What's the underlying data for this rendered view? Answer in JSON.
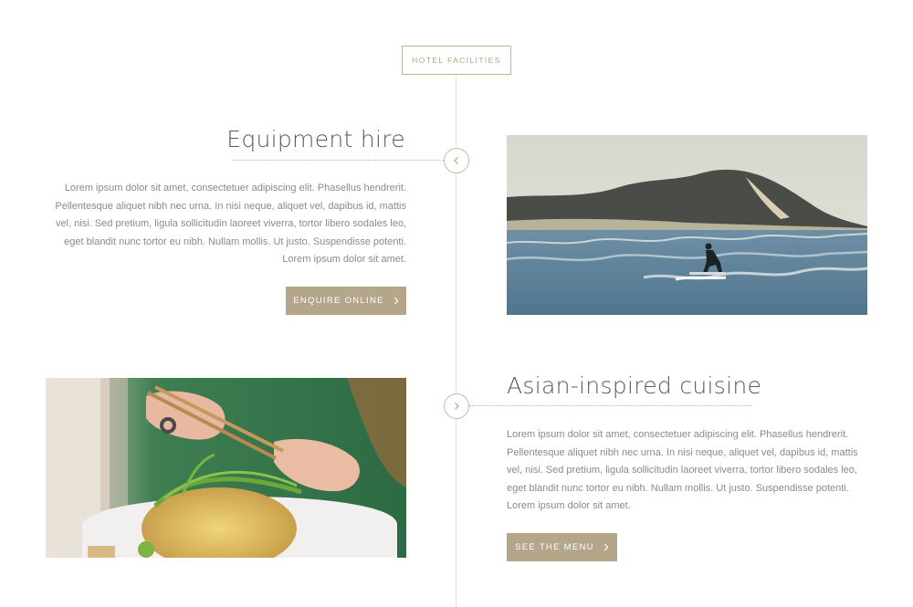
{
  "section": {
    "tag": "HOTEL FACILITIES"
  },
  "items": [
    {
      "title": "Equipment hire",
      "body": "Lorem ipsum dolor sit amet, consectetuer adipiscing elit. Phasellus hendrerit. Pellentesque aliquet nibh nec urna. In nisi neque, aliquet vel, dapibus id, mattis vel, nisi. Sed pretium, ligula sollicitudin laoreet viverra, tortor libero sodales leo, eget blandit nunc tortor eu nibh. Nullam mollis. Ut justo. Suspendisse potenti. Lorem ipsum dolor sit amet.",
      "button": "ENQUIRE ONLINE",
      "node_icon": "chevron-left-icon",
      "photo": "surfer-ocean-photo"
    },
    {
      "title": "Asian-inspired cuisine",
      "body": "Lorem ipsum dolor sit amet, consectetuer adipiscing elit. Phasellus hendrerit. Pellentesque aliquet nibh nec urna. In nisi neque, aliquet vel, dapibus id, mattis vel, nisi. Sed pretium, ligula sollicitudin laoreet viverra, tortor libero sodales leo, eget blandit nunc tortor eu nibh. Nullam mollis. Ut justo. Suspendisse potenti. Lorem ipsum dolor sit amet.",
      "button": "SEE THE MENU",
      "node_icon": "chevron-right-icon",
      "photo": "noodle-dish-photo"
    }
  ],
  "colors": {
    "accent": "#b4a68a",
    "line": "#e6e2d8",
    "text": "#8a8a8a",
    "title": "#5a5a5a"
  }
}
